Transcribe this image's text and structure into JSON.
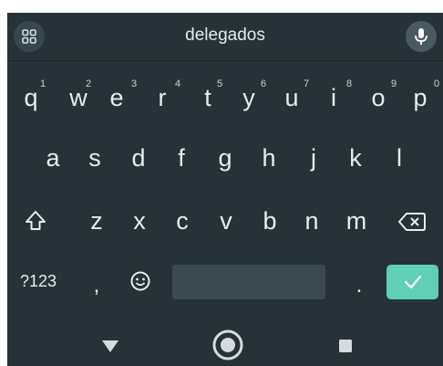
{
  "suggestion": {
    "word": "delegados"
  },
  "rows": {
    "row1": [
      {
        "label": "q",
        "hint": "1"
      },
      {
        "label": "w",
        "hint": "2"
      },
      {
        "label": "e",
        "hint": "3"
      },
      {
        "label": "r",
        "hint": "4"
      },
      {
        "label": "t",
        "hint": "5"
      },
      {
        "label": "y",
        "hint": "6"
      },
      {
        "label": "u",
        "hint": "7"
      },
      {
        "label": "i",
        "hint": "8"
      },
      {
        "label": "o",
        "hint": "9"
      },
      {
        "label": "p",
        "hint": "0"
      }
    ],
    "row2": [
      "a",
      "s",
      "d",
      "f",
      "g",
      "h",
      "j",
      "k",
      "l"
    ],
    "row3": [
      "z",
      "x",
      "c",
      "v",
      "b",
      "n",
      "m"
    ]
  },
  "bottom": {
    "symbols_label": "?123",
    "comma": ",",
    "period": "."
  },
  "colors": {
    "keyboard_bg": "#263238",
    "enter_accent": "#5fcfb7",
    "key_text": "#e7ecee"
  },
  "icons": {
    "grid": "grid-icon",
    "mic": "mic-icon",
    "shift": "shift-icon",
    "backspace": "backspace-icon",
    "emoji": "emoji-icon",
    "enter": "check-icon",
    "back": "back-triangle-icon",
    "home": "home-circle-icon",
    "recents": "recents-square-icon"
  }
}
